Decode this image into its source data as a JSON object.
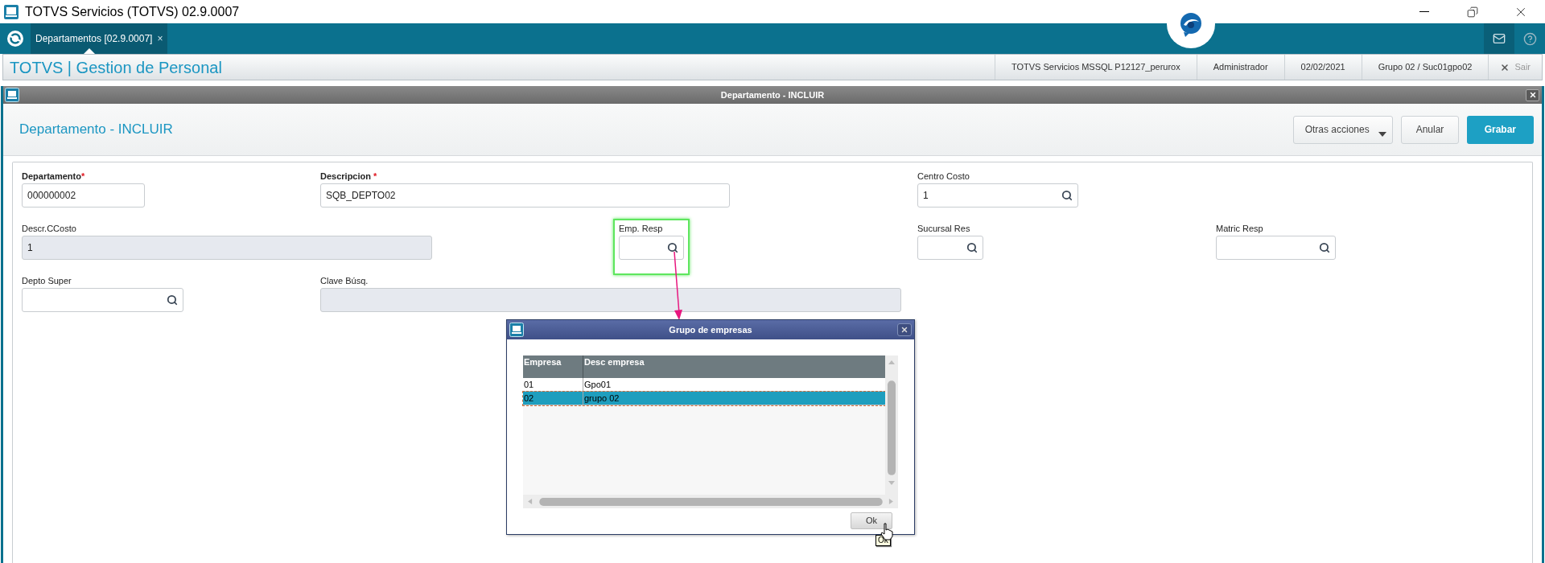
{
  "window": {
    "title": "TOTVS Servicios (TOTVS) 02.9.0007"
  },
  "app_bar": {
    "tabs": [
      {
        "label": "Departamentos [02.9.0007]",
        "close": "×",
        "selected": true
      }
    ]
  },
  "header": {
    "title": "TOTVS | Gestion de Personal",
    "status": [
      "TOTVS Servicios MSSQL P12127_perurox",
      "Administrador",
      "02/02/2021",
      "Grupo 02 / Suc01gpo02"
    ],
    "exit": "Sair"
  },
  "form_window": {
    "title": "Departamento - INCLUIR",
    "heading": "Departamento - INCLUIR",
    "actions": [
      {
        "label": "Otras acciones",
        "kind": "menu"
      },
      {
        "label": "Anular",
        "kind": "default"
      },
      {
        "label": "Grabar",
        "kind": "primary"
      }
    ],
    "fields": [
      {
        "label": "Departamento",
        "required_mark": "*",
        "value": "000000002",
        "kind": "text",
        "highlighted": false
      },
      {
        "label": "Descripcion",
        "required_mark": "*",
        "value": "SQB_DEPTO02",
        "kind": "text",
        "highlighted": false
      },
      {
        "label": "Centro Costo",
        "value": "1",
        "kind": "lookup",
        "highlighted": false
      },
      {
        "label": "Descr.CCosto",
        "value": "1",
        "kind": "readonly",
        "highlighted": false
      },
      {
        "label": "Emp. Resp",
        "kind": "lookup",
        "highlighted": true
      },
      {
        "label": "Sucursal Res",
        "kind": "lookup",
        "highlighted": false
      },
      {
        "label": "Matric Resp",
        "kind": "lookup",
        "highlighted": false
      },
      {
        "label": "Depto Super",
        "kind": "lookup",
        "highlighted": false
      },
      {
        "label": "Clave Búsq.",
        "kind": "readonly",
        "highlighted": false
      }
    ]
  },
  "dialog": {
    "title": "Grupo de empresas",
    "columns": [
      "Empresa",
      "Desc empresa"
    ],
    "rows": [
      {
        "cells": [
          "01",
          "Gpo01"
        ],
        "selected": false
      },
      {
        "cells": [
          "02",
          "grupo 02"
        ],
        "selected": true
      }
    ],
    "ok_button": "Ok",
    "tooltip": "Ok"
  }
}
